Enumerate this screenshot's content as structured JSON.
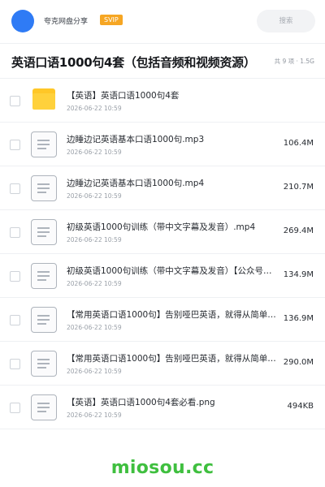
{
  "header": {
    "site_name": "夸克网盘分享",
    "badge": "SVIP",
    "search_placeholder": "搜索"
  },
  "folder": {
    "title": "英语口语1000句4套（包括音频和视频资源）",
    "summary": "共 9 项 · 1.5G"
  },
  "files": [
    {
      "type": "folder",
      "name": "【英语】英语口语1000句4套",
      "date": "2026-06-22 10:59",
      "size": ""
    },
    {
      "type": "file",
      "name": "边睡边记英语基本口语1000句.mp3",
      "date": "2026-06-22 10:59",
      "size": "106.4M"
    },
    {
      "type": "file",
      "name": "边睡边记英语基本口语1000句.mp4",
      "date": "2026-06-22 10:59",
      "size": "210.7M"
    },
    {
      "type": "file",
      "name": "初级英语1000句训练（带中文字幕及发音）.mp4",
      "date": "2026-06-22 10:59",
      "size": "269.4M"
    },
    {
      "type": "file",
      "name": "初级英语1000句训练（带中文字幕及发音）【公众号…",
      "date": "2026-06-22 10:59",
      "size": "134.9M"
    },
    {
      "type": "file",
      "name": "【常用英语口语1000句】告别哑巴英语，就得从简单…",
      "date": "2026-06-22 10:59",
      "size": "136.9M"
    },
    {
      "type": "file",
      "name": "【常用英语口语1000句】告别哑巴英语，就得从简单…",
      "date": "2026-06-22 10:59",
      "size": "290.0M"
    },
    {
      "type": "file",
      "name": "【英语】英语口语1000句4套必看.png",
      "date": "2026-06-22 10:59",
      "size": "494KB"
    }
  ],
  "watermark": "miosou.cc",
  "colors": {
    "avatar": "#2f7bf5",
    "badge": "#f6a623",
    "folder_icon": "#ffd13b",
    "watermark": "#3fbf3f"
  },
  "icons": {
    "folder": "folder-icon",
    "file": "file-icon"
  }
}
